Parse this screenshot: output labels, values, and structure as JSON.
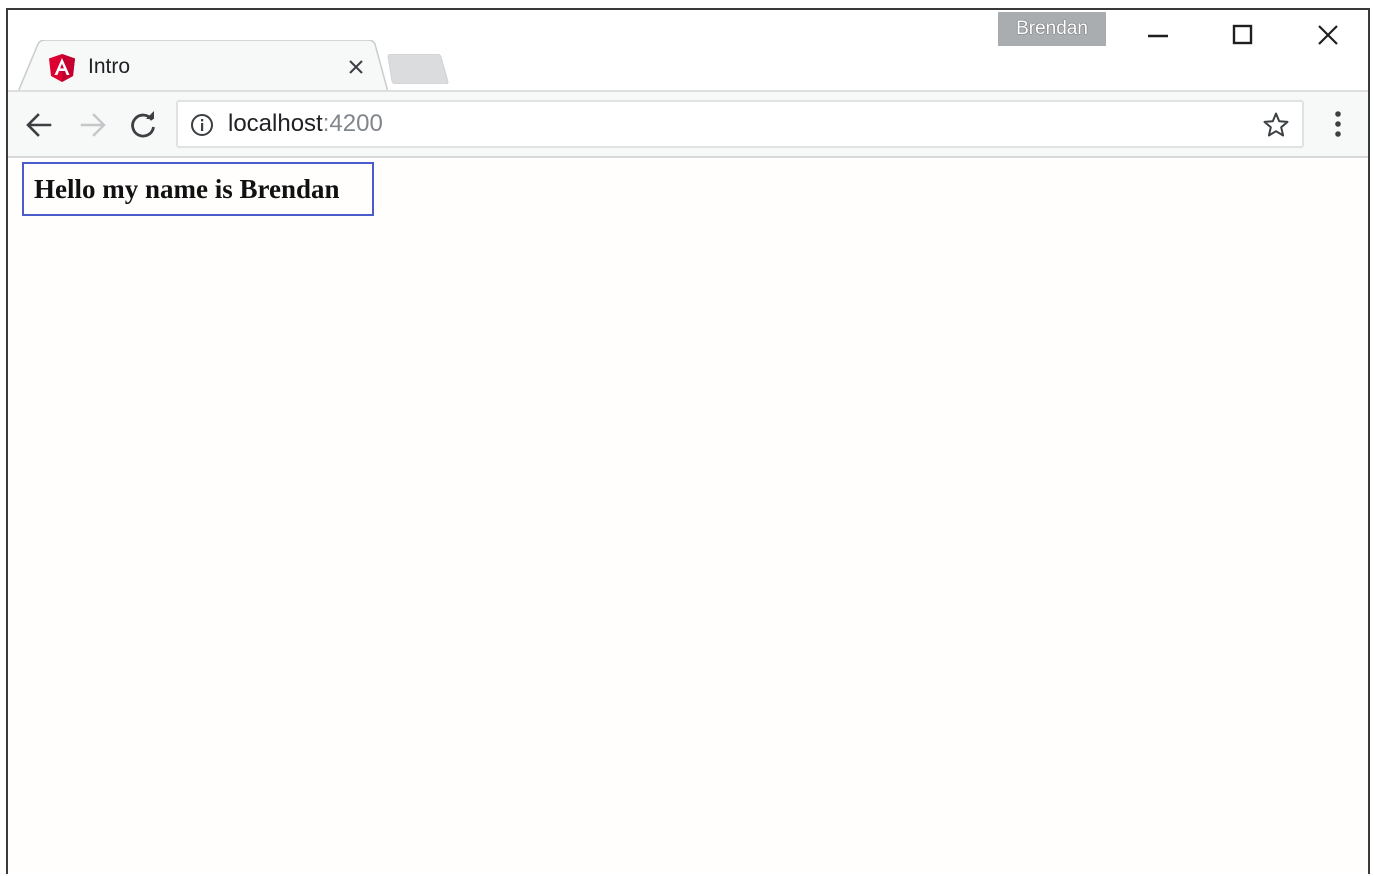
{
  "window": {
    "profile_name": "Brendan",
    "controls": {
      "minimize_icon": "minimize-icon",
      "maximize_icon": "maximize-icon",
      "close_icon": "close-icon"
    }
  },
  "tab": {
    "title": "Intro",
    "favicon": "angular-logo",
    "close_icon": "close-icon"
  },
  "toolbar": {
    "back_icon": "arrow-left-icon",
    "forward_icon": "arrow-right-icon",
    "reload_icon": "reload-icon",
    "info_icon": "info-icon",
    "bookmark_icon": "star-icon",
    "menu_icon": "more-vertical-icon",
    "url": {
      "host": "localhost",
      "port": ":4200"
    }
  },
  "page": {
    "heading": "Hello my name is Brendan"
  },
  "colors": {
    "highlight_border": "#4a5cc9",
    "angular_red": "#dd0031",
    "profile_badge": "#a9adb0",
    "toolbar_bg": "#f7f8f8"
  }
}
